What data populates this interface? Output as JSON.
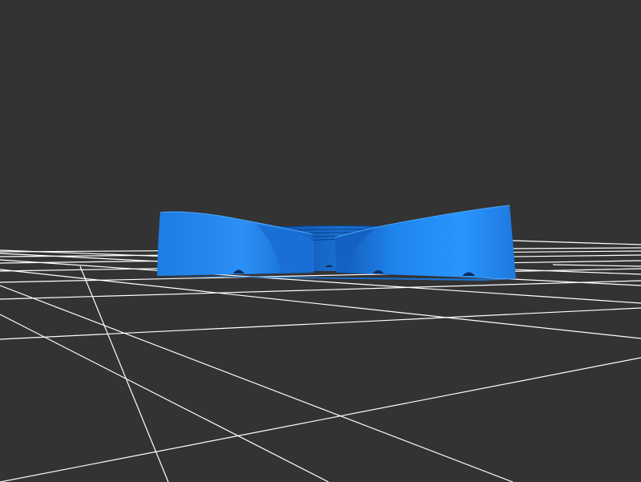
{
  "viewport": {
    "background_color": "#333333",
    "grid_color": "#ffffff",
    "model_color": "#1e88f0",
    "model_shadow_color": "#0f4fa8",
    "model_highlight_color": "#3aa0ff",
    "grid_visible": true
  }
}
